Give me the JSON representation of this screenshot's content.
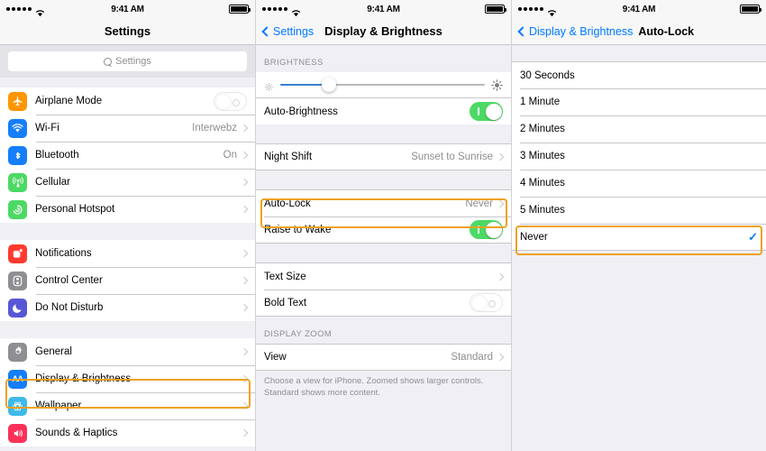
{
  "status_bar": {
    "time": "9:41 AM",
    "signal_dots": 5,
    "wifi": "wifi-icon",
    "battery": "battery-full-icon"
  },
  "accent_colors": {
    "highlight": "#efa11d",
    "link_blue": "#007aff",
    "toggle_on_green": "#4cd964",
    "value_gray": "#8e8e93"
  },
  "screen1": {
    "title": "Settings",
    "search": {
      "placeholder": "Settings",
      "icon": "search-icon"
    },
    "groups": [
      {
        "rows": [
          {
            "label": "Airplane Mode",
            "icon": "airplane-icon",
            "icon_color": "#ff9500",
            "control": "toggle",
            "toggle_on": false
          },
          {
            "label": "Wi-Fi",
            "icon": "wifi-icon",
            "icon_color": "#147efb",
            "value": "Interwebz",
            "control": "chevron"
          },
          {
            "label": "Bluetooth",
            "icon": "bluetooth-icon",
            "icon_color": "#147efb",
            "value": "On",
            "control": "chevron"
          },
          {
            "label": "Cellular",
            "icon": "cellular-icon",
            "icon_color": "#4cd964",
            "value": "",
            "control": "chevron"
          },
          {
            "label": "Personal Hotspot",
            "icon": "hotspot-icon",
            "icon_color": "#4cd964",
            "value": "",
            "control": "chevron"
          }
        ]
      },
      {
        "rows": [
          {
            "label": "Notifications",
            "icon": "notifications-icon",
            "icon_color": "#ff3b30",
            "value": "",
            "control": "chevron"
          },
          {
            "label": "Control Center",
            "icon": "control-center-icon",
            "icon_color": "#8e8e93",
            "value": "",
            "control": "chevron"
          },
          {
            "label": "Do Not Disturb",
            "icon": "do-not-disturb-icon",
            "icon_color": "#5757d4",
            "value": "",
            "control": "chevron"
          }
        ]
      },
      {
        "rows": [
          {
            "label": "General",
            "icon": "gear-icon",
            "icon_color": "#8e8e93",
            "value": "",
            "control": "chevron"
          },
          {
            "label": "Display & Brightness",
            "icon": "display-brightness-icon",
            "icon_color": "#147efb",
            "value": "",
            "control": "chevron",
            "highlighted": true
          },
          {
            "label": "Wallpaper",
            "icon": "wallpaper-icon",
            "icon_color": "#3fb9ea",
            "value": "",
            "control": "chevron"
          },
          {
            "label": "Sounds & Haptics",
            "icon": "sounds-haptics-icon",
            "icon_color": "#fc3158",
            "value": "",
            "control": "chevron"
          }
        ]
      }
    ]
  },
  "screen2": {
    "back_label": "Settings",
    "title": "Display & Brightness",
    "brightness_header": "BRIGHTNESS",
    "slider": {
      "value_percent": 24,
      "low_icon": "sun-small-icon",
      "high_icon": "sun-large-icon"
    },
    "rows_brightness": [
      {
        "label": "Auto-Brightness",
        "control": "toggle",
        "toggle_on": true
      }
    ],
    "rows_nightshift": [
      {
        "label": "Night Shift",
        "value": "Sunset to Sunrise",
        "control": "chevron"
      }
    ],
    "rows_lock": [
      {
        "label": "Auto-Lock",
        "value": "Never",
        "control": "chevron",
        "highlighted": true
      },
      {
        "label": "Raise to Wake",
        "control": "toggle",
        "toggle_on": true
      }
    ],
    "rows_text": [
      {
        "label": "Text Size",
        "value": "",
        "control": "chevron"
      },
      {
        "label": "Bold Text",
        "control": "toggle",
        "toggle_on": false
      }
    ],
    "zoom_header": "DISPLAY ZOOM",
    "rows_zoom": [
      {
        "label": "View",
        "value": "Standard",
        "control": "chevron"
      }
    ],
    "zoom_footer": "Choose a view for iPhone. Zoomed shows larger controls. Standard shows more content."
  },
  "screen3": {
    "back_label": "Display & Brightness",
    "title": "Auto-Lock",
    "options": [
      {
        "label": "30 Seconds",
        "selected": false
      },
      {
        "label": "1 Minute",
        "selected": false
      },
      {
        "label": "2 Minutes",
        "selected": false
      },
      {
        "label": "3 Minutes",
        "selected": false
      },
      {
        "label": "4 Minutes",
        "selected": false
      },
      {
        "label": "5 Minutes",
        "selected": false
      },
      {
        "label": "Never",
        "selected": true,
        "highlighted": true
      }
    ],
    "checkmark": "✓"
  }
}
